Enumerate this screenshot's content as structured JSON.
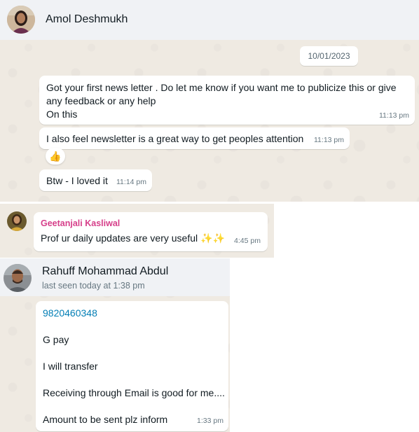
{
  "chat1": {
    "contact_name": "Amol Deshmukh",
    "date_chip": "10/01/2023",
    "messages": [
      {
        "line1": "Got your first news letter . Do let me know if you want me to publicize this or give",
        "line2": "any feedback or any help",
        "line3": "On this",
        "time": "11:13 pm"
      },
      {
        "text": "I also feel newsletter is a great way to get peoples attention",
        "time": "11:13 pm",
        "reaction": "thumbs-up-icon"
      },
      {
        "text": "Btw - I loved it",
        "time": "11:14 pm"
      }
    ]
  },
  "chat2": {
    "sender_name": "Geetanjali Kasliwal",
    "message": "Prof ur daily updates are very useful",
    "emoji": "✨✨",
    "time": "4:45 pm",
    "sender_color": "#d63f8a"
  },
  "chat3": {
    "contact_name": "Rahuff Mohammad Abdul",
    "last_seen": "last seen today at 1:38 pm",
    "phone": "9820460348",
    "lines": [
      "G pay",
      "I will transfer",
      "Receiving through Email is good for me....",
      "Amount to be sent plz inform"
    ],
    "time": "1:33 pm",
    "link_color": "#027eb5"
  }
}
